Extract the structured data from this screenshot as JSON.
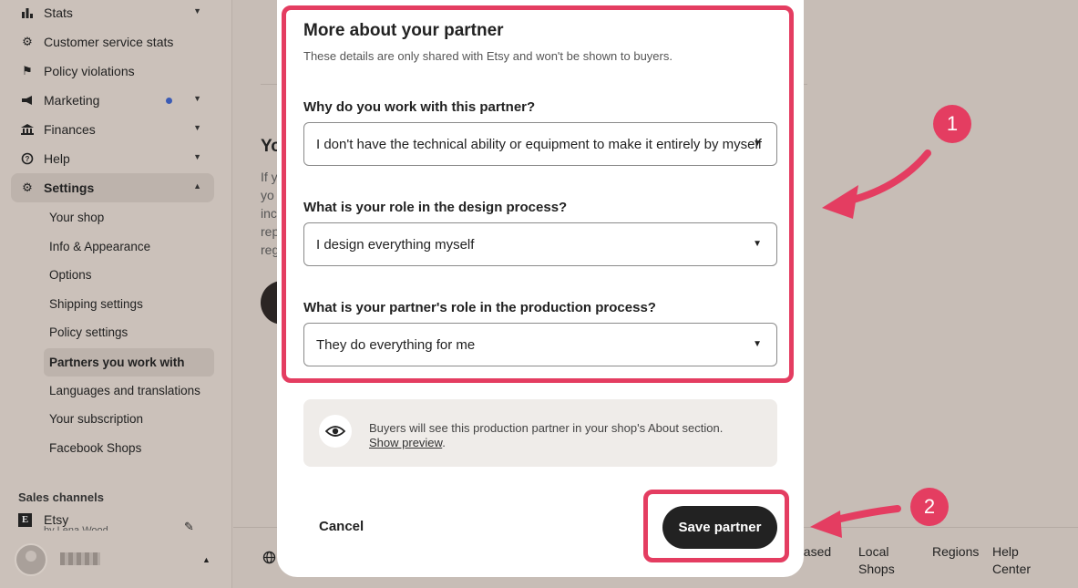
{
  "sidebar": {
    "items": [
      {
        "label": "Stats",
        "icon": "bar-chart-icon"
      },
      {
        "label": "Customer service stats",
        "icon": "gear-icon"
      },
      {
        "label": "Policy violations",
        "icon": "flag-icon"
      },
      {
        "label": "Marketing",
        "icon": "megaphone-icon"
      },
      {
        "label": "Finances",
        "icon": "bank-icon"
      },
      {
        "label": "Help",
        "icon": "help-icon"
      },
      {
        "label": "Settings",
        "icon": "gear-icon"
      }
    ],
    "settings_subitems": [
      "Your shop",
      "Info & Appearance",
      "Options",
      "Shipping settings",
      "Policy settings",
      "Partners you work with",
      "Languages and translations",
      "Your subscription",
      "Facebook Shops"
    ],
    "sales_channels_label": "Sales channels",
    "channel_label": "Etsy",
    "channel_sub": "by Lena Wood"
  },
  "background": {
    "heading": "Yo",
    "lines": [
      "If y",
      "yo",
      "inc",
      "rep",
      "reg"
    ]
  },
  "footer": {
    "links": [
      {
        "line1": "based",
        "line2": ""
      },
      {
        "line1": "Local",
        "line2": "Shops"
      },
      {
        "line1": "Regions",
        "line2": ""
      },
      {
        "line1": "Help",
        "line2": "Center"
      }
    ]
  },
  "modal": {
    "title": "More about your partner",
    "subtitle": "These details are only shared with Etsy and won't be shown to buyers.",
    "q1_label": "Why do you work with this partner?",
    "q1_value": "I don't have the technical ability or equipment to make it entirely by myself",
    "q2_label": "What is your role in the design process?",
    "q2_value": "I design everything myself",
    "q3_label": "What is your partner's role in the production process?",
    "q3_value": "They do everything for me",
    "info_text": "Buyers will see this production partner in your shop's About section.",
    "info_link": "Show preview",
    "info_link_suffix": ".",
    "cancel_label": "Cancel",
    "save_label": "Save partner"
  },
  "annotations": {
    "badge1": "1",
    "badge2": "2",
    "color": "#e43d61"
  }
}
